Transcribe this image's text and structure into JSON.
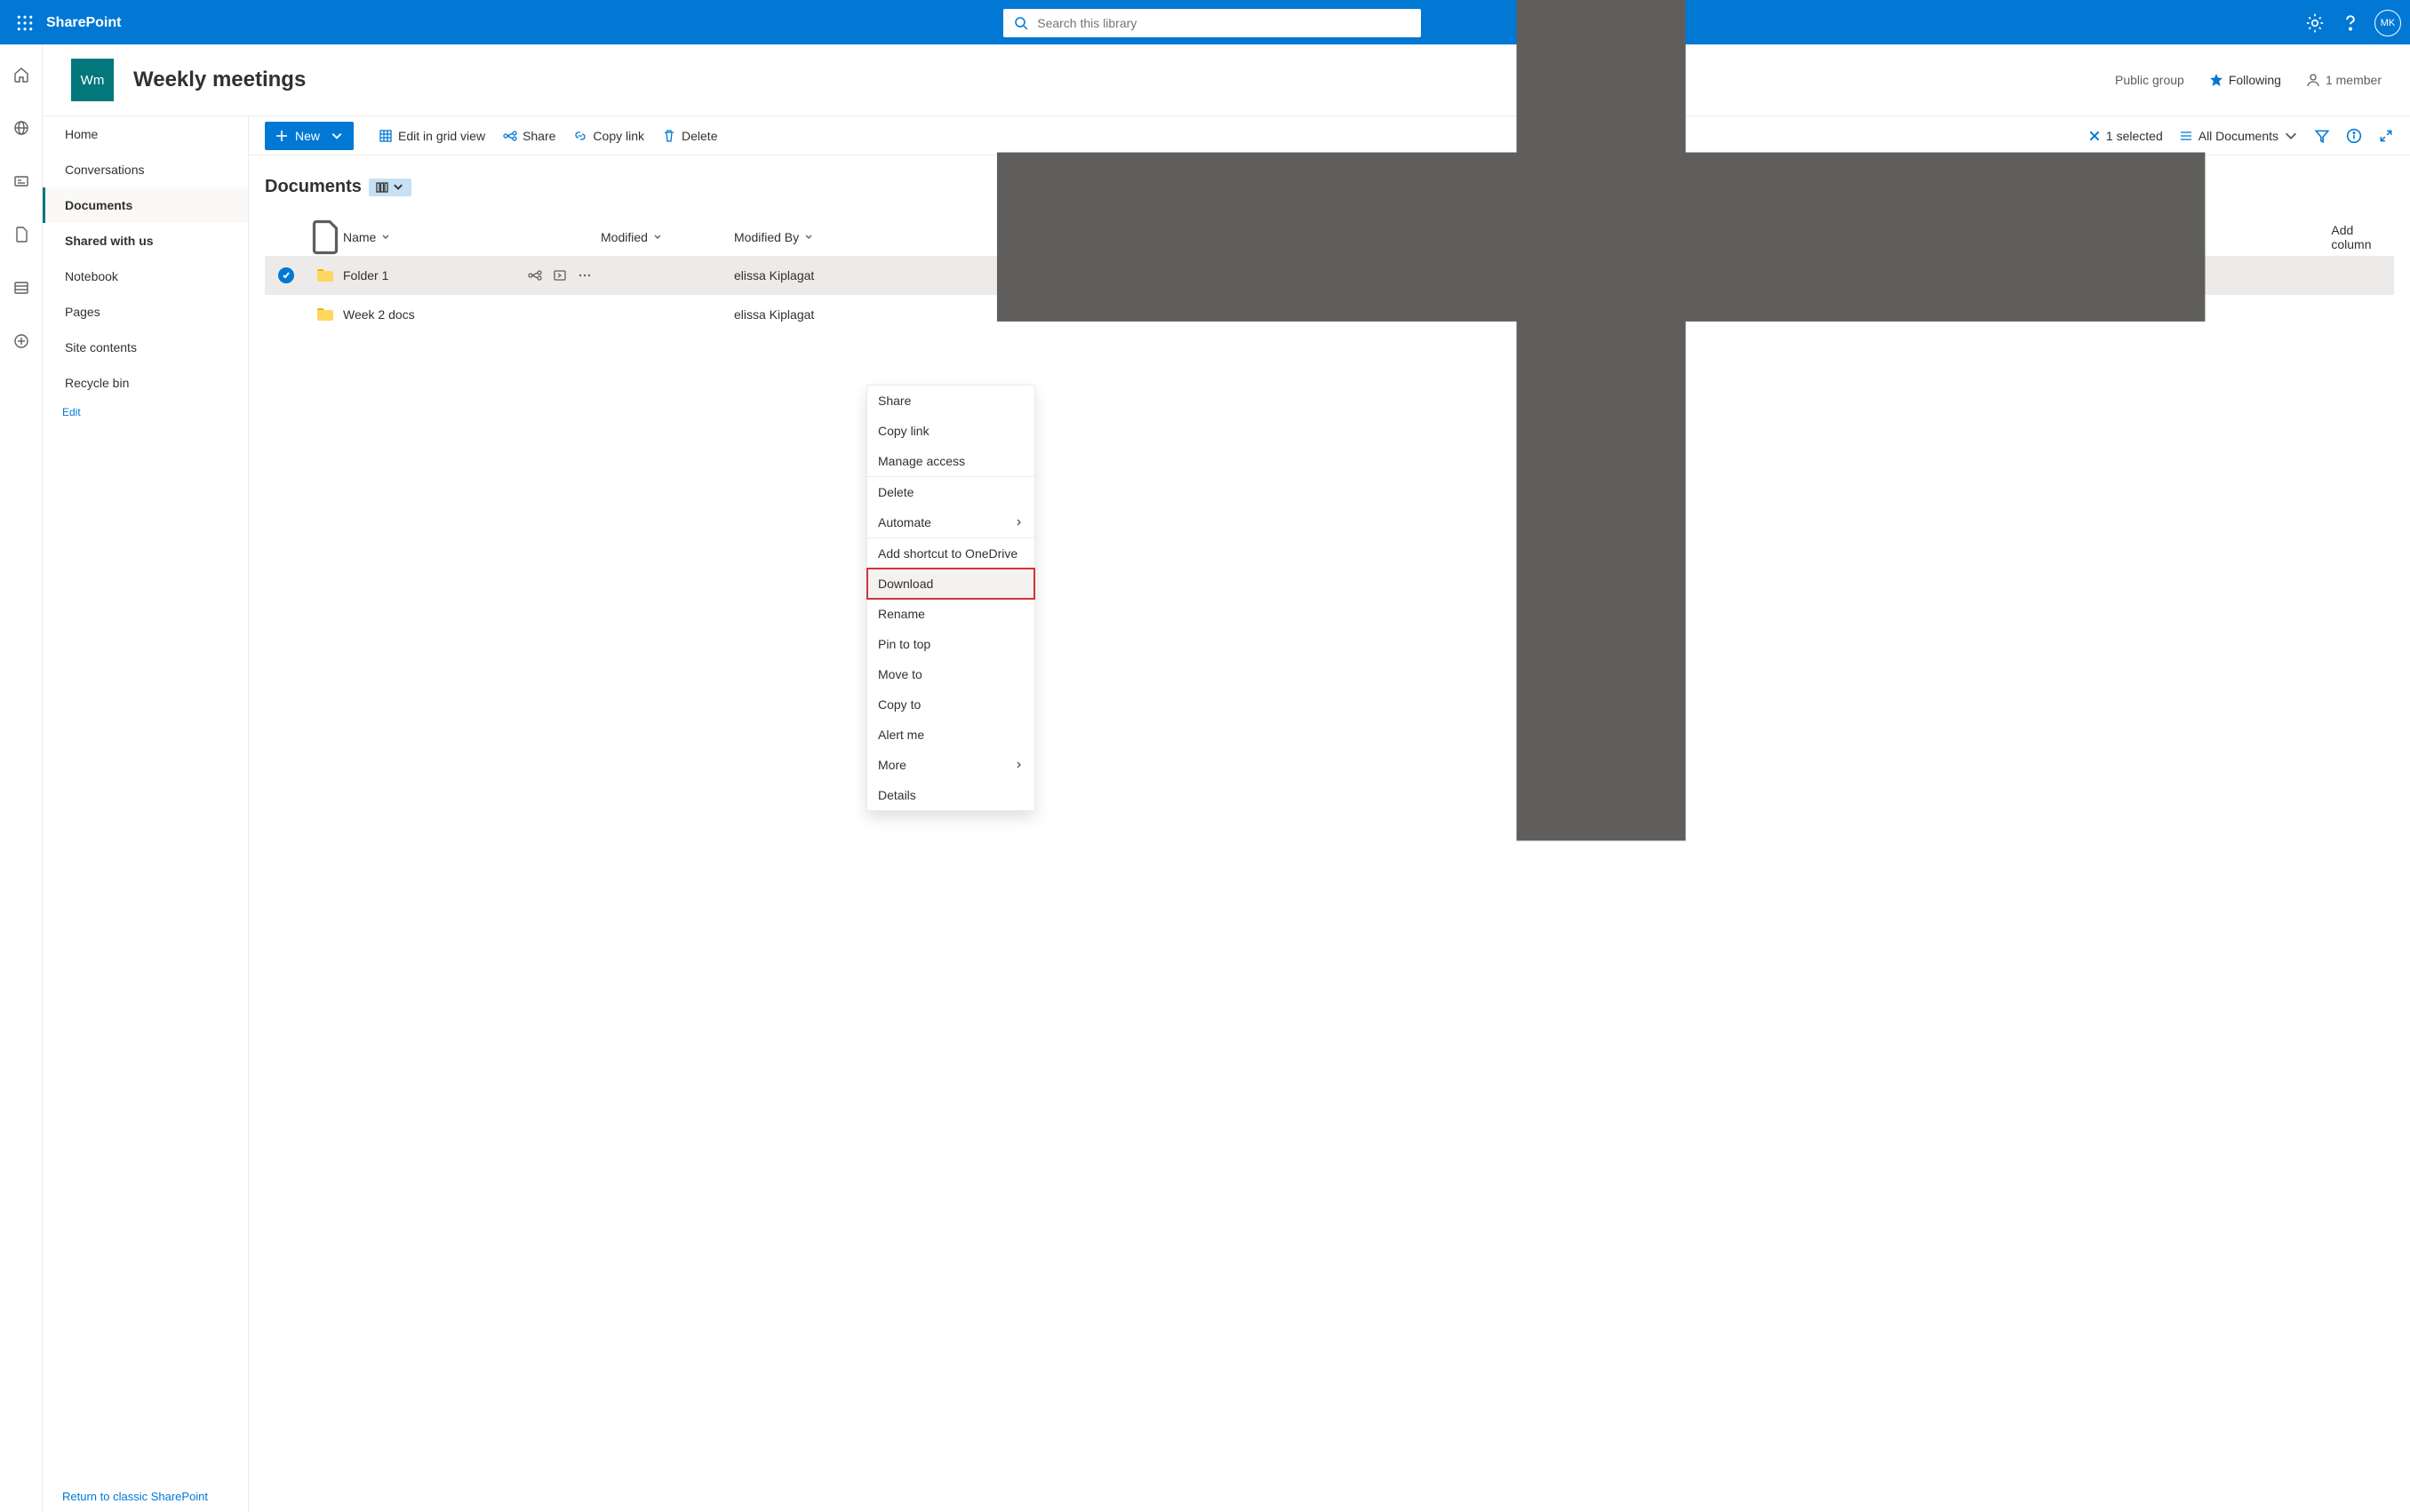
{
  "suite": {
    "product": "SharePoint",
    "search_placeholder": "Search this library",
    "avatar_initials": "MK"
  },
  "site": {
    "logo_text": "Wm",
    "title": "Weekly meetings",
    "group_type": "Public group",
    "following": "Following",
    "members": "1 member"
  },
  "leftnav": {
    "items": [
      "Home",
      "Conversations",
      "Documents",
      "Shared with us",
      "Notebook",
      "Pages",
      "Site contents",
      "Recycle bin"
    ],
    "edit": "Edit",
    "footer": "Return to classic SharePoint"
  },
  "commands": {
    "new": "New",
    "edit_grid": "Edit in grid view",
    "share": "Share",
    "copy_link": "Copy link",
    "delete": "Delete",
    "selected": "1 selected",
    "view": "All Documents"
  },
  "library": {
    "title": "Documents",
    "columns": {
      "name": "Name",
      "modified": "Modified",
      "modified_by": "Modified By",
      "add": "Add column"
    },
    "rows": [
      {
        "name": "Folder 1",
        "modified_by": "elissa Kiplagat"
      },
      {
        "name": "Week 2 docs",
        "modified_by": "elissa Kiplagat"
      }
    ]
  },
  "context_menu": {
    "share": "Share",
    "copy_link": "Copy link",
    "manage_access": "Manage access",
    "delete": "Delete",
    "automate": "Automate",
    "shortcut": "Add shortcut to OneDrive",
    "download": "Download",
    "rename": "Rename",
    "pin": "Pin to top",
    "move": "Move to",
    "copy": "Copy to",
    "alert": "Alert me",
    "more": "More",
    "details": "Details"
  }
}
